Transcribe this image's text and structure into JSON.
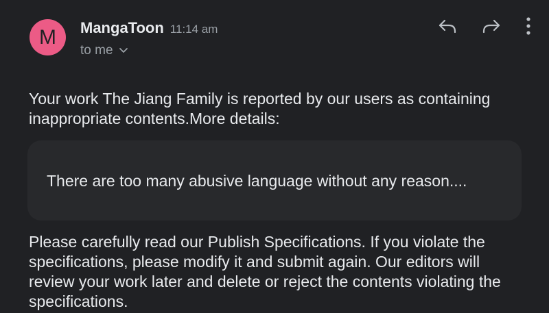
{
  "email": {
    "avatar_letter": "M",
    "avatar_color": "#ec5b86",
    "sender_name": "MangaToon",
    "timestamp": "11:14 am",
    "recipient_label": "to me",
    "icons": {
      "expand": "chevron-down-icon",
      "reply": "reply-icon",
      "forward": "forward-icon",
      "more": "more-vertical-icon"
    },
    "body": {
      "paragraph_1": "Your work The Jiang Family is reported by our users as containing inappropriate contents.More details:",
      "details": "There are too many abusive language without any reason....",
      "paragraph_2": "Please carefully read our Publish Specifications. If you violate the specifications, please modify it and submit again. Our editors will review your work later and delete or reject the contents violating the specifications."
    }
  },
  "colors": {
    "background": "#202124",
    "details_background": "#28292c",
    "primary_text": "#e8eaed",
    "secondary_text": "#9aa0a6"
  }
}
